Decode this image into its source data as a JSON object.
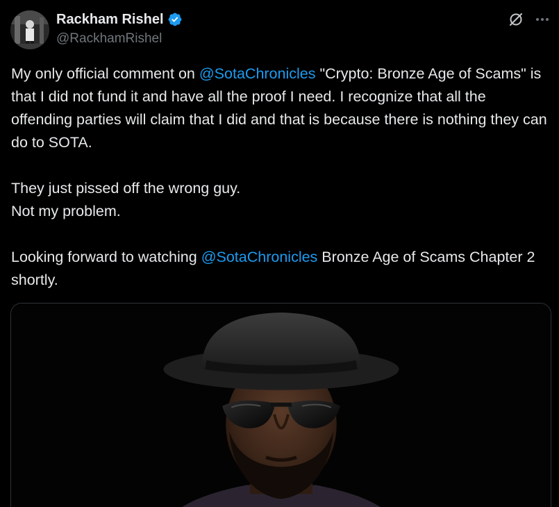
{
  "author": {
    "display_name": "Rackham Rishel",
    "handle": "@RackhamRishel",
    "verified": true,
    "verified_color": "#1d9bf0"
  },
  "actions": {
    "grok_icon": "grok-icon",
    "more_icon": "more-icon"
  },
  "tweet": {
    "line1_pre": "My only official comment on ",
    "mention1": "@SotaChronicles",
    "line1_post": " \"Crypto: Bronze Age of Scams\" is that I did not fund it and have all the proof I need. I recognize that all the offending parties will claim that I did and that is because there is nothing they can do to SOTA.",
    "para2_line1": "They just pissed off the wrong guy.",
    "para2_line2": "Not my problem.",
    "para3_pre": "Looking forward to watching ",
    "mention2": "@SotaChronicles",
    "para3_post": " Bronze Age of Scams Chapter 2 shortly."
  },
  "colors": {
    "background": "#000000",
    "text": "#e7e9ea",
    "secondary": "#71767b",
    "link": "#1d9bf0",
    "border": "#2f3336"
  }
}
